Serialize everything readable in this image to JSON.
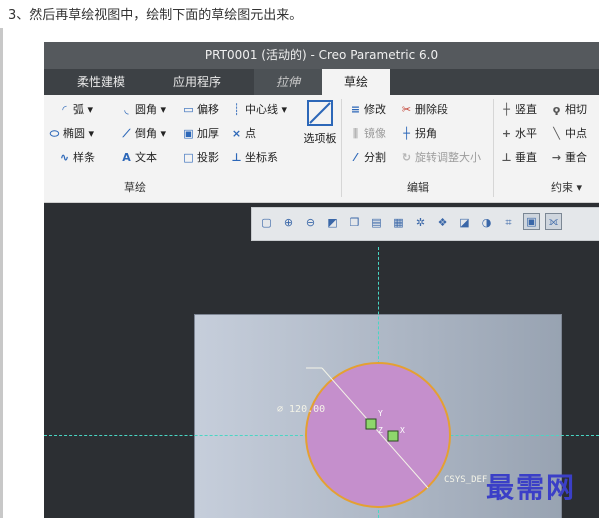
{
  "caption": "3、然后再草绘视图中，绘制下面的草绘图元出来。",
  "window": {
    "title": "PRT0001 (活动的) - Creo Parametric 6.0"
  },
  "tabs": [
    {
      "label": "柔性建模",
      "state": "normal"
    },
    {
      "label": "应用程序",
      "state": "normal"
    },
    {
      "label": "拉伸",
      "state": "italic"
    },
    {
      "label": "草绘",
      "state": "active"
    }
  ],
  "ribbon": {
    "sketch": {
      "items": [
        "弧",
        "圆角",
        "偏移",
        "中心线",
        "椭圆",
        "倒角",
        "加厚",
        "点",
        "样条",
        "文本",
        "投影",
        "坐标系"
      ],
      "palette_button": "选项板",
      "group_label": "草绘"
    },
    "edit": {
      "items": [
        "修改",
        "删除段",
        "镜像",
        "拐角",
        "分割",
        "旋转调整大小"
      ],
      "group_label": "编辑"
    },
    "constrain": {
      "items": [
        "竖直",
        "相切",
        "水平",
        "中点",
        "垂直",
        "重合"
      ],
      "group_label": "约束"
    }
  },
  "sketch": {
    "dimension_text": "⌀ 120.00",
    "csys_label": "CSYS_DEF",
    "axis_y": "Y",
    "axis_z": "Z",
    "axis_x": "X"
  },
  "watermark": "最需网",
  "colors": {
    "circle_fill": "#c58fcc",
    "circle_stroke": "#e4a032",
    "centerline": "#49d6c4",
    "background": "#2c2f33"
  }
}
